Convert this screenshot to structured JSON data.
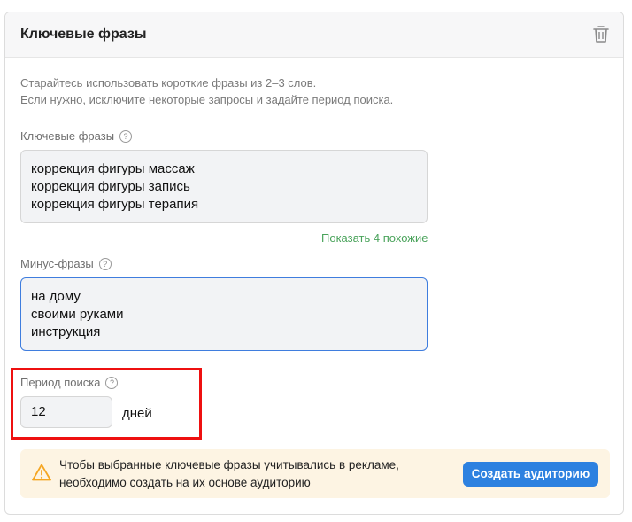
{
  "card": {
    "title": "Ключевые фразы",
    "hint_lines": [
      "Старайтесь использовать короткие фразы из 2–3 слов.",
      "Если нужно, исключите некоторые запросы и задайте период поиска."
    ]
  },
  "keywords": {
    "label": "Ключевые фразы",
    "lines": [
      "коррекция фигуры массаж",
      "коррекция фигуры запись",
      "коррекция фигуры терапия"
    ],
    "similar_link": "Показать 4 похожие"
  },
  "minus": {
    "label": "Минус-фразы",
    "lines": [
      "на дому",
      "своими руками",
      "инструкция"
    ]
  },
  "period": {
    "label": "Период поиска",
    "value": "12",
    "unit": "дней"
  },
  "banner": {
    "lines": [
      "Чтобы выбранные ключевые фразы учитывались в рекламе,",
      "необходимо создать на их основе аудиторию"
    ],
    "button": "Создать аудиторию"
  },
  "icons": {
    "help": "?",
    "trash": "trash-icon",
    "warning": "warning-icon"
  },
  "colors": {
    "accent": "#2d81e0",
    "link_green": "#4aa35b",
    "highlight_red": "#ee1010",
    "banner_bg": "#fdf4e3",
    "warning": "#f5a623"
  }
}
